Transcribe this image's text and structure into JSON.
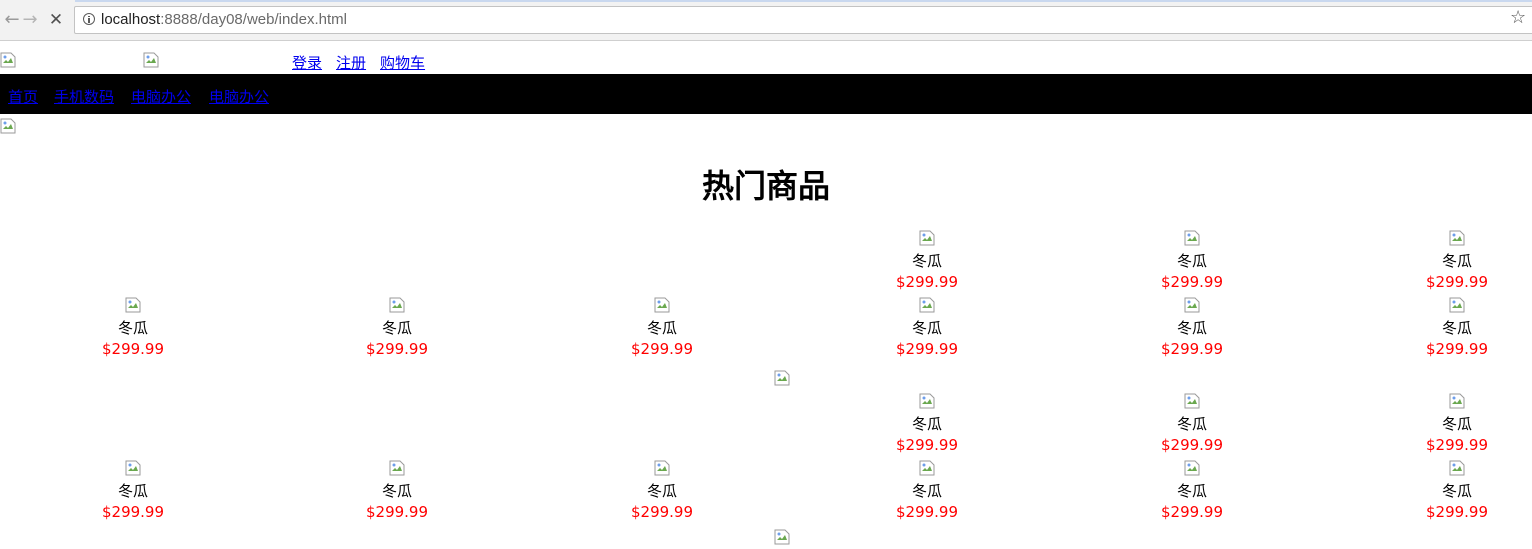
{
  "browser": {
    "url_host": "localhost",
    "url_rest": ":8888/day08/web/index.html"
  },
  "header": {
    "links": [
      "登录",
      "注册",
      "购物车"
    ]
  },
  "menu": {
    "items": [
      "首页",
      "手机数码",
      "电脑办公",
      "电脑办公"
    ]
  },
  "main": {
    "heading": "热门商品",
    "product_name": "冬瓜",
    "product_price": "$299.99",
    "products": [
      {
        "name": "冬瓜",
        "price": "$299.99"
      },
      {
        "name": "冬瓜",
        "price": "$299.99"
      },
      {
        "name": "冬瓜",
        "price": "$299.99"
      },
      {
        "name": "冬瓜",
        "price": "$299.99"
      },
      {
        "name": "冬瓜",
        "price": "$299.99"
      },
      {
        "name": "冬瓜",
        "price": "$299.99"
      },
      {
        "name": "冬瓜",
        "price": "$299.99"
      },
      {
        "name": "冬瓜",
        "price": "$299.99"
      },
      {
        "name": "冬瓜",
        "price": "$299.99"
      },
      {
        "name": "冬瓜",
        "price": "$299.99"
      },
      {
        "name": "冬瓜",
        "price": "$299.99"
      },
      {
        "name": "冬瓜",
        "price": "$299.99"
      },
      {
        "name": "冬瓜",
        "price": "$299.99"
      },
      {
        "name": "冬瓜",
        "price": "$299.99"
      },
      {
        "name": "冬瓜",
        "price": "$299.99"
      },
      {
        "name": "冬瓜",
        "price": "$299.99"
      },
      {
        "name": "冬瓜",
        "price": "$299.99"
      },
      {
        "name": "冬瓜",
        "price": "$299.99"
      }
    ]
  },
  "icons": {
    "broken_image": "broken-image-icon",
    "back": "back-arrow-icon",
    "forward": "forward-arrow-icon",
    "stop": "stop-icon",
    "info": "info-icon",
    "bookmark": "star-icon"
  },
  "colors": {
    "menubar_bg": "#000000",
    "link": "#0000ee",
    "price": "#ff0000"
  }
}
